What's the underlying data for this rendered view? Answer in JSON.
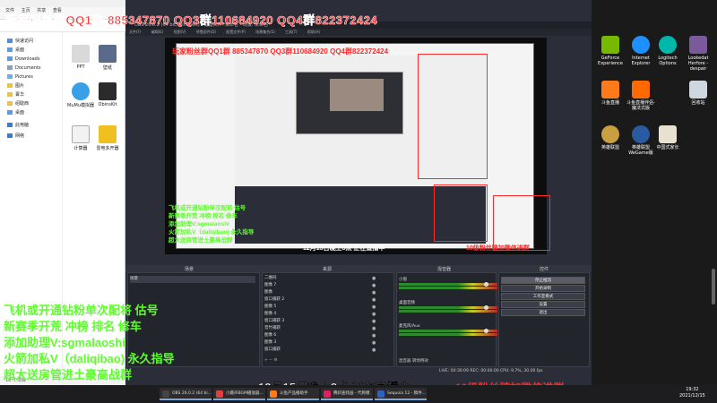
{
  "overlay": {
    "top_qq": "玩家粉丝群QQ1群 885347870 QQ3群110684920 QQ4群822372424",
    "top_qq_small": "玩家粉丝群QQ1群 885347870 QQ3群110684920 QQ4群822372424",
    "green_lines": [
      "飞机或开通钻粉单次配将 估号",
      "新赛季开荒  冲榜  排名 修车",
      "添加助理V:sgmalaoshi",
      "火箭加私V（daliqibao) 永久指导",
      "超大送房管进土豪高战群"
    ],
    "bottom_center": "12月15日晚上8点  正在直播中",
    "bottom_right": "10级粉丝牌加微信进群",
    "small_center": "12月15日晚上8点  正在直播中",
    "small_right": "10级粉丝牌加微信进群"
  },
  "explorer": {
    "title": "桌面",
    "ribbon_tabs": [
      "文件",
      "主页",
      "共享",
      "查看"
    ],
    "nav_items": [
      "快速访问",
      "桌面",
      "Downloads",
      "Documents",
      "Pictures",
      "图片",
      "菁华",
      "绍耽西",
      "桌面",
      "此电脑",
      "网络"
    ],
    "files": [
      {
        "label": "PPT",
        "color": "#d9d9d9"
      },
      {
        "label": "壁纸",
        "color": "#5a6a8a"
      },
      {
        "label": "MuMu模拟器",
        "color": "#3aa0e6"
      },
      {
        "label": "ObinsKit",
        "color": "#2b2b2b"
      },
      {
        "label": "计算器",
        "color": "#f2f2f2"
      },
      {
        "label": "雷电多开器",
        "color": "#f0c020"
      }
    ],
    "status": "16 个项目"
  },
  "obs": {
    "title": "OBS 26.0.2 (64 bit, windows) - 配置文件: 未命名 - 场景: 未命名",
    "menu": [
      "文件(F)",
      "编辑(E)",
      "视图(V)",
      "停靠部件(D)",
      "配置文件(P)",
      "场景集合(S)",
      "工具(T)",
      "帮助(H)"
    ],
    "docks": {
      "scenes_title": "场景",
      "sources_title": "来源",
      "mixer_title": "混音器",
      "controls_title": "控件",
      "scenes": [
        "场景"
      ],
      "sources": [
        "二维码",
        "图像 7",
        "图像",
        "窗口捕获 2",
        "图像 5",
        "图像 4",
        "窗口捕获 3",
        "音竹捕获",
        "图像 6",
        "图像 3",
        "窗口捕获"
      ],
      "mixer": [
        {
          "label": "小窗",
          "db": "0.0 dB"
        },
        {
          "label": "桌面音频",
          "db": "0.0 dB"
        },
        {
          "label": "麦克风/Aux",
          "db": "0.0 dB"
        }
      ],
      "controls": [
        "停止推流",
        "开始录制",
        "工作室模式",
        "设置",
        "退出"
      ],
      "tabs": [
        "混音器",
        "转场特效"
      ]
    },
    "status": "LIVE: 00:30:09   REC: 00:00:00   CPU: 9.7%, 30.00 fps"
  },
  "desktop": {
    "icons": [
      {
        "label": "GeForce Experience",
        "color": "#76b900"
      },
      {
        "label": "Internet Explorer",
        "color": "#1e90ff"
      },
      {
        "label": "Logitech Options",
        "color": "#00b8a9"
      },
      {
        "label": "Lookedat Herfore - despair",
        "color": "#7a5a9a"
      },
      {
        "label": "斗鱼直播",
        "color": "#ff7a1a"
      },
      {
        "label": "斗鱼直播伴侣-魔法式版",
        "color": "#ff6a00"
      },
      {
        "label": "回收站",
        "color": "#cfd8e0"
      },
      {
        "label": "英雄联盟",
        "color": "#c8a040"
      },
      {
        "label": "英雄联盟WeGame版",
        "color": "#2a5aa0"
      },
      {
        "label": "中国式家长",
        "color": "#e8e0d0"
      }
    ]
  },
  "taskbar": {
    "items": [
      {
        "label": "OBS 26.0.2 (64 bi...",
        "color": "#444"
      },
      {
        "label": "小藤声BGM播放器...",
        "color": "#e04040"
      },
      {
        "label": "斗鱼产品播助手",
        "color": "#ff7a1a"
      },
      {
        "label": "腾斜查找画 - 代称模",
        "color": "#e02060"
      },
      {
        "label": "Sequoia 12 - 稿件...",
        "color": "#3060c0"
      }
    ],
    "time": "19:32",
    "date": "2021/12/15"
  }
}
